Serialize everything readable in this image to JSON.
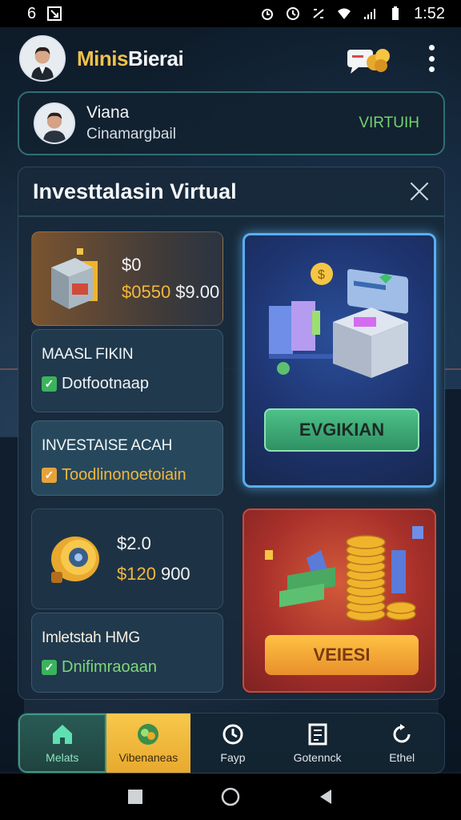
{
  "status_bar": {
    "left1": "6",
    "time": "1:52"
  },
  "header": {
    "title_part1": "Mi",
    "title_part2": "nis",
    "title_part3": "Bierai"
  },
  "profile": {
    "name": "Viana",
    "subtitle": "Cinamargbail",
    "tag": "VIRTUIH"
  },
  "panel": {
    "title": "Investtalasin Virtual",
    "price_card_1": {
      "top": "$0",
      "value_a": "$0550",
      "value_b": "$9.00"
    },
    "feature_1": {
      "title": "MAASL FIKIN",
      "check_label": "Dotfootnaap"
    },
    "feature_2": {
      "title": "INVESTAISE ACAH",
      "check_label": "Toodlinonoetoiain"
    },
    "price_card_2": {
      "top": "$2.0",
      "value_a": "$120",
      "value_b": "900"
    },
    "feature_3": {
      "title": "Imletstah HMG",
      "check_label": "Dnifimraoaan"
    },
    "promo_1_button": "EVGIKIAN",
    "promo_2_button": "VEIESI"
  },
  "nav": {
    "items": [
      {
        "label": "Melats"
      },
      {
        "label": "Vibenaneas"
      },
      {
        "label": "Fayp"
      },
      {
        "label": "Gotennck"
      },
      {
        "label": "Ethel"
      }
    ]
  },
  "colors": {
    "accent_gold": "#f0c24a",
    "accent_green": "#76d26f",
    "promo_blue_border": "#5aaef0"
  }
}
